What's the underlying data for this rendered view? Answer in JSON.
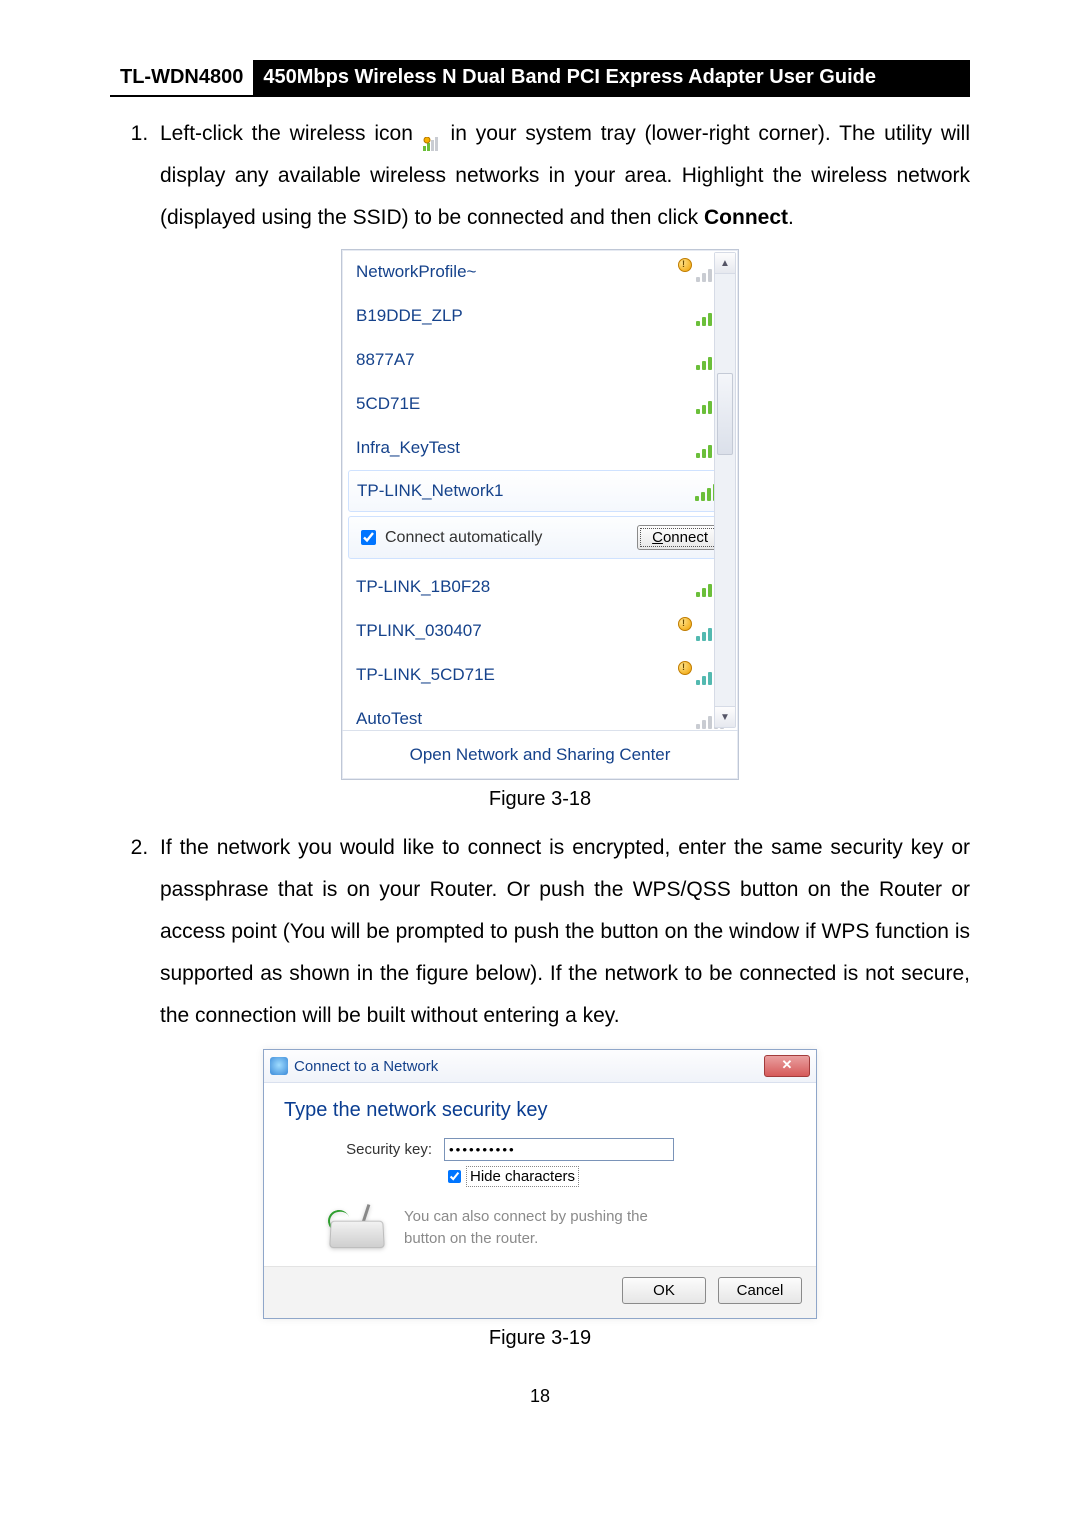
{
  "header": {
    "model": "TL-WDN4800",
    "title": "450Mbps Wireless N Dual Band PCI Express Adapter User Guide"
  },
  "steps": {
    "s1": {
      "num": "1.",
      "pre": "Left-click the wireless icon ",
      "post": " in your system tray (lower-right corner). The utility will display any available wireless networks in your area. Highlight the wireless network (displayed using the SSID) to be connected and then click ",
      "bold": "Connect",
      "end": "."
    },
    "s2": {
      "num": "2.",
      "text": "If the network you would like to connect is encrypted, enter the same security key or passphrase that is on your Router. Or push the WPS/QSS button on the Router or access point (You will be prompted to push the button on the window if WPS function is supported as shown in the figure below). If the network to be connected is not secure, the connection will be built without entering a key."
    }
  },
  "figcaps": {
    "f1": "Figure 3-18",
    "f2": "Figure 3-19"
  },
  "flyout": {
    "networks": [
      {
        "name": "NetworkProfile~",
        "shield": true,
        "style": "grey"
      },
      {
        "name": "B19DDE_ZLP",
        "shield": false,
        "style": "green"
      },
      {
        "name": "8877A7",
        "shield": false,
        "style": "green"
      },
      {
        "name": "5CD71E",
        "shield": false,
        "style": "green"
      },
      {
        "name": "Infra_KeyTest",
        "shield": false,
        "style": "green"
      },
      {
        "name": "TP-LINK_Network1",
        "shield": false,
        "style": "green",
        "selected": true
      },
      {
        "name": "TP-LINK_1B0F28",
        "shield": false,
        "style": "green"
      },
      {
        "name": "TPLINK_030407",
        "shield": true,
        "style": "teal"
      },
      {
        "name": "TP-LINK_5CD71E",
        "shield": true,
        "style": "teal"
      },
      {
        "name": "AutoTest",
        "shield": false,
        "style": "grey"
      }
    ],
    "auto_label": "Connect automatically",
    "auto_checked": true,
    "connect_label": "Connect",
    "footer_link": "Open Network and Sharing Center"
  },
  "dialog": {
    "title": "Connect to a Network",
    "heading": "Type the network security key",
    "key_label": "Security key:",
    "key_value": "••••••••••",
    "hide_label": "Hide characters",
    "hide_checked": true,
    "router_note_l1": "You can also connect by pushing the",
    "router_note_l2": "button on the router.",
    "ok": "OK",
    "cancel": "Cancel"
  },
  "page_number": "18"
}
